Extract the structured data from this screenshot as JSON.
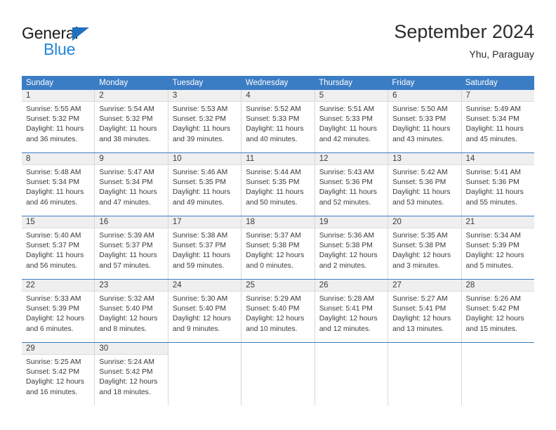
{
  "brand": {
    "name_top": "General",
    "name_bottom": "Blue",
    "triangle_color": "#1f72bd",
    "blue_color": "#1f86d8"
  },
  "header": {
    "title": "September 2024",
    "location": "Yhu, Paraguay"
  },
  "theme": {
    "header_blue": "#3b7dc4",
    "daynum_band": "#efefef",
    "cell_border": "#d8d8d8",
    "text": "#3a3a3a"
  },
  "weekdays": [
    "Sunday",
    "Monday",
    "Tuesday",
    "Wednesday",
    "Thursday",
    "Friday",
    "Saturday"
  ],
  "weeks": [
    [
      {
        "day": "1",
        "sunrise": "Sunrise: 5:55 AM",
        "sunset": "Sunset: 5:32 PM",
        "daylight1": "Daylight: 11 hours",
        "daylight2": "and 36 minutes."
      },
      {
        "day": "2",
        "sunrise": "Sunrise: 5:54 AM",
        "sunset": "Sunset: 5:32 PM",
        "daylight1": "Daylight: 11 hours",
        "daylight2": "and 38 minutes."
      },
      {
        "day": "3",
        "sunrise": "Sunrise: 5:53 AM",
        "sunset": "Sunset: 5:32 PM",
        "daylight1": "Daylight: 11 hours",
        "daylight2": "and 39 minutes."
      },
      {
        "day": "4",
        "sunrise": "Sunrise: 5:52 AM",
        "sunset": "Sunset: 5:33 PM",
        "daylight1": "Daylight: 11 hours",
        "daylight2": "and 40 minutes."
      },
      {
        "day": "5",
        "sunrise": "Sunrise: 5:51 AM",
        "sunset": "Sunset: 5:33 PM",
        "daylight1": "Daylight: 11 hours",
        "daylight2": "and 42 minutes."
      },
      {
        "day": "6",
        "sunrise": "Sunrise: 5:50 AM",
        "sunset": "Sunset: 5:33 PM",
        "daylight1": "Daylight: 11 hours",
        "daylight2": "and 43 minutes."
      },
      {
        "day": "7",
        "sunrise": "Sunrise: 5:49 AM",
        "sunset": "Sunset: 5:34 PM",
        "daylight1": "Daylight: 11 hours",
        "daylight2": "and 45 minutes."
      }
    ],
    [
      {
        "day": "8",
        "sunrise": "Sunrise: 5:48 AM",
        "sunset": "Sunset: 5:34 PM",
        "daylight1": "Daylight: 11 hours",
        "daylight2": "and 46 minutes."
      },
      {
        "day": "9",
        "sunrise": "Sunrise: 5:47 AM",
        "sunset": "Sunset: 5:34 PM",
        "daylight1": "Daylight: 11 hours",
        "daylight2": "and 47 minutes."
      },
      {
        "day": "10",
        "sunrise": "Sunrise: 5:46 AM",
        "sunset": "Sunset: 5:35 PM",
        "daylight1": "Daylight: 11 hours",
        "daylight2": "and 49 minutes."
      },
      {
        "day": "11",
        "sunrise": "Sunrise: 5:44 AM",
        "sunset": "Sunset: 5:35 PM",
        "daylight1": "Daylight: 11 hours",
        "daylight2": "and 50 minutes."
      },
      {
        "day": "12",
        "sunrise": "Sunrise: 5:43 AM",
        "sunset": "Sunset: 5:36 PM",
        "daylight1": "Daylight: 11 hours",
        "daylight2": "and 52 minutes."
      },
      {
        "day": "13",
        "sunrise": "Sunrise: 5:42 AM",
        "sunset": "Sunset: 5:36 PM",
        "daylight1": "Daylight: 11 hours",
        "daylight2": "and 53 minutes."
      },
      {
        "day": "14",
        "sunrise": "Sunrise: 5:41 AM",
        "sunset": "Sunset: 5:36 PM",
        "daylight1": "Daylight: 11 hours",
        "daylight2": "and 55 minutes."
      }
    ],
    [
      {
        "day": "15",
        "sunrise": "Sunrise: 5:40 AM",
        "sunset": "Sunset: 5:37 PM",
        "daylight1": "Daylight: 11 hours",
        "daylight2": "and 56 minutes."
      },
      {
        "day": "16",
        "sunrise": "Sunrise: 5:39 AM",
        "sunset": "Sunset: 5:37 PM",
        "daylight1": "Daylight: 11 hours",
        "daylight2": "and 57 minutes."
      },
      {
        "day": "17",
        "sunrise": "Sunrise: 5:38 AM",
        "sunset": "Sunset: 5:37 PM",
        "daylight1": "Daylight: 11 hours",
        "daylight2": "and 59 minutes."
      },
      {
        "day": "18",
        "sunrise": "Sunrise: 5:37 AM",
        "sunset": "Sunset: 5:38 PM",
        "daylight1": "Daylight: 12 hours",
        "daylight2": "and 0 minutes."
      },
      {
        "day": "19",
        "sunrise": "Sunrise: 5:36 AM",
        "sunset": "Sunset: 5:38 PM",
        "daylight1": "Daylight: 12 hours",
        "daylight2": "and 2 minutes."
      },
      {
        "day": "20",
        "sunrise": "Sunrise: 5:35 AM",
        "sunset": "Sunset: 5:38 PM",
        "daylight1": "Daylight: 12 hours",
        "daylight2": "and 3 minutes."
      },
      {
        "day": "21",
        "sunrise": "Sunrise: 5:34 AM",
        "sunset": "Sunset: 5:39 PM",
        "daylight1": "Daylight: 12 hours",
        "daylight2": "and 5 minutes."
      }
    ],
    [
      {
        "day": "22",
        "sunrise": "Sunrise: 5:33 AM",
        "sunset": "Sunset: 5:39 PM",
        "daylight1": "Daylight: 12 hours",
        "daylight2": "and 6 minutes."
      },
      {
        "day": "23",
        "sunrise": "Sunrise: 5:32 AM",
        "sunset": "Sunset: 5:40 PM",
        "daylight1": "Daylight: 12 hours",
        "daylight2": "and 8 minutes."
      },
      {
        "day": "24",
        "sunrise": "Sunrise: 5:30 AM",
        "sunset": "Sunset: 5:40 PM",
        "daylight1": "Daylight: 12 hours",
        "daylight2": "and 9 minutes."
      },
      {
        "day": "25",
        "sunrise": "Sunrise: 5:29 AM",
        "sunset": "Sunset: 5:40 PM",
        "daylight1": "Daylight: 12 hours",
        "daylight2": "and 10 minutes."
      },
      {
        "day": "26",
        "sunrise": "Sunrise: 5:28 AM",
        "sunset": "Sunset: 5:41 PM",
        "daylight1": "Daylight: 12 hours",
        "daylight2": "and 12 minutes."
      },
      {
        "day": "27",
        "sunrise": "Sunrise: 5:27 AM",
        "sunset": "Sunset: 5:41 PM",
        "daylight1": "Daylight: 12 hours",
        "daylight2": "and 13 minutes."
      },
      {
        "day": "28",
        "sunrise": "Sunrise: 5:26 AM",
        "sunset": "Sunset: 5:42 PM",
        "daylight1": "Daylight: 12 hours",
        "daylight2": "and 15 minutes."
      }
    ],
    [
      {
        "day": "29",
        "sunrise": "Sunrise: 5:25 AM",
        "sunset": "Sunset: 5:42 PM",
        "daylight1": "Daylight: 12 hours",
        "daylight2": "and 16 minutes."
      },
      {
        "day": "30",
        "sunrise": "Sunrise: 5:24 AM",
        "sunset": "Sunset: 5:42 PM",
        "daylight1": "Daylight: 12 hours",
        "daylight2": "and 18 minutes."
      },
      {
        "day": "",
        "sunrise": "",
        "sunset": "",
        "daylight1": "",
        "daylight2": ""
      },
      {
        "day": "",
        "sunrise": "",
        "sunset": "",
        "daylight1": "",
        "daylight2": ""
      },
      {
        "day": "",
        "sunrise": "",
        "sunset": "",
        "daylight1": "",
        "daylight2": ""
      },
      {
        "day": "",
        "sunrise": "",
        "sunset": "",
        "daylight1": "",
        "daylight2": ""
      },
      {
        "day": "",
        "sunrise": "",
        "sunset": "",
        "daylight1": "",
        "daylight2": ""
      }
    ]
  ]
}
